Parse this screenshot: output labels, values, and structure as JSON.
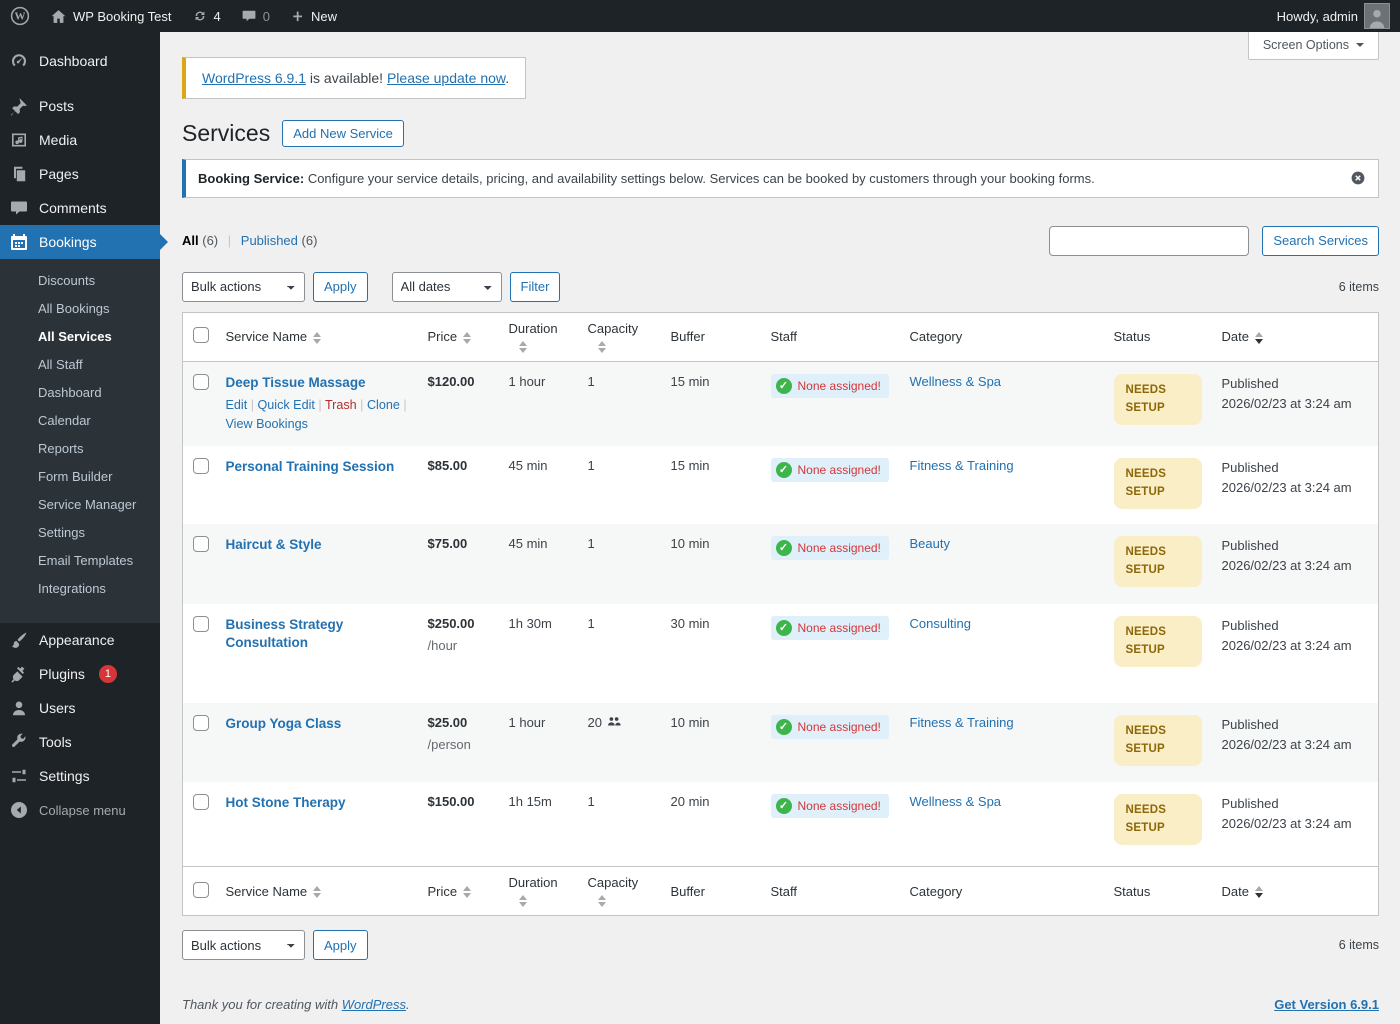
{
  "admin_bar": {
    "site_name": "WP Booking Test",
    "update_count": "4",
    "comment_count": "0",
    "new_label": "New",
    "howdy": "Howdy, admin"
  },
  "sidebar": {
    "items": [
      {
        "label": "Dashboard",
        "icon": "dashboard-icon"
      },
      {
        "label": "Posts",
        "icon": "pin-icon"
      },
      {
        "label": "Media",
        "icon": "media-icon"
      },
      {
        "label": "Pages",
        "icon": "pages-icon"
      },
      {
        "label": "Comments",
        "icon": "comments-icon"
      },
      {
        "label": "Bookings",
        "icon": "calendar-icon",
        "active": true
      },
      {
        "label": "Appearance",
        "icon": "brush-icon"
      },
      {
        "label": "Plugins",
        "icon": "plug-icon",
        "badge": "1"
      },
      {
        "label": "Users",
        "icon": "user-icon"
      },
      {
        "label": "Tools",
        "icon": "wrench-icon"
      },
      {
        "label": "Settings",
        "icon": "sliders-icon"
      },
      {
        "label": "Collapse menu",
        "icon": "collapse-icon"
      }
    ],
    "submenu": [
      "Discounts",
      "All Bookings",
      "All Services",
      "All Staff",
      "Dashboard",
      "Calendar",
      "Reports",
      "Form Builder",
      "Service Manager",
      "Settings",
      "Email Templates",
      "Integrations"
    ],
    "submenu_current": "All Services"
  },
  "screen_options": "Screen Options",
  "update_nag": {
    "link1": "WordPress 6.9.1",
    "middle": " is available! ",
    "link2": "Please update now",
    "period": "."
  },
  "page": {
    "title": "Services",
    "add_button": "Add New Service"
  },
  "notice": {
    "bold": "Booking Service:",
    "text": " Configure your service details, pricing, and availability settings below. Services can be booked by customers through your booking forms."
  },
  "filters": {
    "all_label": "All",
    "all_count": "(6)",
    "published_label": "Published",
    "published_count": "(6)",
    "search_button": "Search Services"
  },
  "tablenav": {
    "bulk_actions": "Bulk actions",
    "apply": "Apply",
    "all_dates": "All dates",
    "filter": "Filter",
    "items_count": "6 items"
  },
  "table": {
    "columns": [
      {
        "key": "name",
        "label": "Service Name",
        "sortable": true,
        "arrows": "inline"
      },
      {
        "key": "price",
        "label": "Price",
        "sortable": true,
        "arrows": "inline"
      },
      {
        "key": "duration",
        "label": "Duration",
        "sortable": true,
        "arrows": "below"
      },
      {
        "key": "capacity",
        "label": "Capacity",
        "sortable": true,
        "arrows": "below"
      },
      {
        "key": "buffer",
        "label": "Buffer",
        "sortable": false
      },
      {
        "key": "staff",
        "label": "Staff",
        "sortable": false
      },
      {
        "key": "category",
        "label": "Category",
        "sortable": false
      },
      {
        "key": "status",
        "label": "Status",
        "sortable": false
      },
      {
        "key": "date",
        "label": "Date",
        "sortable": true,
        "arrows": "inline",
        "sorted": "desc"
      }
    ],
    "row_actions": [
      "Edit",
      "Quick Edit",
      "Trash",
      "Clone",
      "View Bookings"
    ],
    "rows": [
      {
        "name": "Deep Tissue Massage",
        "has_actions": true,
        "price": "$120.00",
        "price_suffix": "",
        "duration": "1 hour",
        "capacity": "1",
        "capacity_group": false,
        "buffer": "15 min",
        "staff": "None assigned!",
        "category": "Wellness & Spa",
        "status": "NEEDS SETUP",
        "date1": "Published",
        "date2": "2026/02/23 at 3:24 am"
      },
      {
        "name": "Personal Training Session",
        "has_actions": false,
        "price": "$85.00",
        "price_suffix": "",
        "duration": "45 min",
        "capacity": "1",
        "capacity_group": false,
        "buffer": "15 min",
        "staff": "None assigned!",
        "category": "Fitness & Training",
        "status": "NEEDS SETUP",
        "date1": "Published",
        "date2": "2026/02/23 at 3:24 am"
      },
      {
        "name": "Haircut & Style",
        "has_actions": false,
        "price": "$75.00",
        "price_suffix": "",
        "duration": "45 min",
        "capacity": "1",
        "capacity_group": false,
        "buffer": "10 min",
        "staff": "None assigned!",
        "category": "Beauty",
        "status": "NEEDS SETUP",
        "date1": "Published",
        "date2": "2026/02/23 at 3:24 am"
      },
      {
        "name": "Business Strategy Consultation",
        "has_actions": false,
        "price": "$250.00",
        "price_suffix": "/hour",
        "duration": "1h 30m",
        "capacity": "1",
        "capacity_group": false,
        "buffer": "30 min",
        "staff": "None assigned!",
        "category": "Consulting",
        "status": "NEEDS SETUP",
        "date1": "Published",
        "date2": "2026/02/23 at 3:24 am"
      },
      {
        "name": "Group Yoga Class",
        "has_actions": false,
        "price": "$25.00",
        "price_suffix": "/person",
        "duration": "1 hour",
        "capacity": "20",
        "capacity_group": true,
        "buffer": "10 min",
        "staff": "None assigned!",
        "category": "Fitness & Training",
        "status": "NEEDS SETUP",
        "date1": "Published",
        "date2": "2026/02/23 at 3:24 am"
      },
      {
        "name": "Hot Stone Therapy",
        "has_actions": false,
        "price": "$150.00",
        "price_suffix": "",
        "duration": "1h 15m",
        "capacity": "1",
        "capacity_group": false,
        "buffer": "20 min",
        "staff": "None assigned!",
        "category": "Wellness & Spa",
        "status": "NEEDS SETUP",
        "date1": "Published",
        "date2": "2026/02/23 at 3:24 am"
      }
    ]
  },
  "footer": {
    "thanks_text": "Thank you for creating with ",
    "thanks_link": "WordPress",
    "period": ".",
    "version_link": "Get Version 6.9.1"
  }
}
